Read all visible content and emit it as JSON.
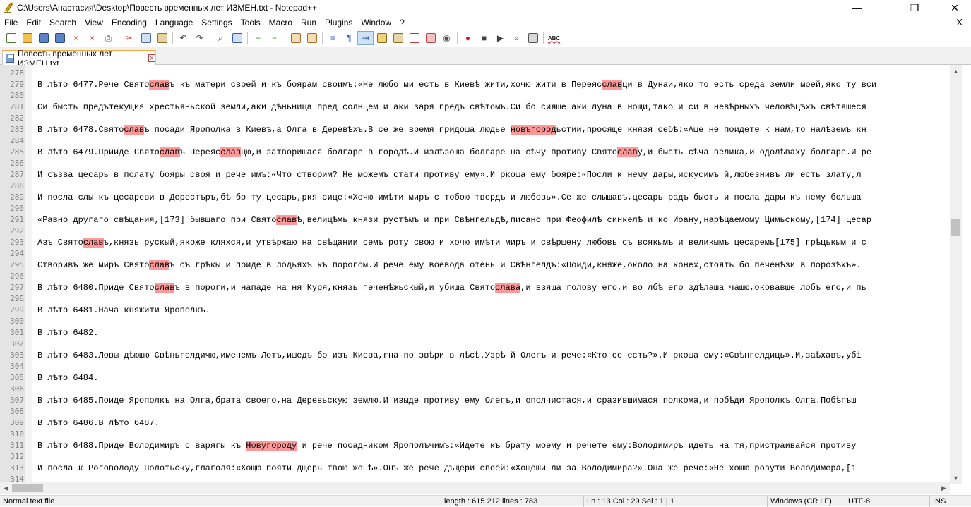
{
  "window": {
    "title": "C:\\Users\\Анастасия\\Desktop\\Повесть временных лет ИЗМЕН.txt - Notepad++",
    "minimize_glyph": "—",
    "restore_glyph": "❐",
    "close_glyph": "✕"
  },
  "menu": [
    "File",
    "Edit",
    "Search",
    "View",
    "Encoding",
    "Language",
    "Settings",
    "Tools",
    "Macro",
    "Run",
    "Plugins",
    "Window",
    "?"
  ],
  "menu_close": "X",
  "toolbar": {
    "icons": [
      "new-file-icon",
      "open-file-icon",
      "save-icon",
      "save-all-icon",
      "close-icon",
      "close-all-icon",
      "print-icon",
      "sep",
      "cut-icon",
      "copy-icon",
      "paste-icon",
      "sep",
      "undo-icon",
      "redo-icon",
      "sep",
      "find-icon",
      "replace-icon",
      "sep",
      "zoom-in-icon",
      "zoom-out-icon",
      "sep",
      "sync-vertical-icon",
      "sync-horizontal-icon",
      "sep",
      "word-wrap-icon",
      "show-all-characters-icon",
      "indent-guide-icon",
      "user-defined-language-icon",
      "document-map-icon",
      "function-list-icon",
      "folder-as-workspace-icon",
      "monitoring-icon",
      "sep",
      "record-macro-icon",
      "stop-recording-icon",
      "playback-macro-icon",
      "run-macro-multiple-icon",
      "save-macro-icon",
      "sep",
      "spell-check-icon"
    ],
    "active": "indent-guide-icon",
    "spell_label": "ABC"
  },
  "tab": {
    "label": "Повесть временных лет ИЗМЕН.txt",
    "close_glyph": "x"
  },
  "editor": {
    "lines": [
      {
        "n": "278",
        "segs": []
      },
      {
        "n": "279",
        "segs": [
          {
            "t": "В лѣто 6477.Рече Свято"
          },
          {
            "t": "слав",
            "h": 1
          },
          {
            "t": "ъ къ матери своей и къ боярам своимъ:«Не любо ми есть в Киевѣ жити,хочю жити в Переяс"
          },
          {
            "t": "слав",
            "h": 1
          },
          {
            "t": "ци в Дунаи,яко то есть среда земли моей,яко ту вси"
          }
        ]
      },
      {
        "n": "280",
        "segs": []
      },
      {
        "n": "281",
        "segs": [
          {
            "t": "Си бысть предътекущия хрестьяньской земли,аки дѣньница пред солнцем и аки заря предъ свѣтомъ.Си бо сияше аки луна в нощи,тако и си в невѣрныхъ человѣцѣхъ свѣтяшеся"
          }
        ]
      },
      {
        "n": "282",
        "segs": []
      },
      {
        "n": "283",
        "segs": [
          {
            "t": "В лѣто 6478.Свято"
          },
          {
            "t": "слав",
            "h": 1
          },
          {
            "t": "ъ посади Ярополка в Киевѣ,а Олга в Деревѣхъ.В се же время придоша людье "
          },
          {
            "t": "новъгород",
            "h": 1
          },
          {
            "t": "ьстии,просяще князя себѣ:«Аще не поидете к нам,то налѣземъ кн"
          }
        ]
      },
      {
        "n": "284",
        "segs": []
      },
      {
        "n": "285",
        "segs": [
          {
            "t": "В лѣто 6479.Прииде Свято"
          },
          {
            "t": "слав",
            "h": 1
          },
          {
            "t": "ъ Переяс"
          },
          {
            "t": "слав",
            "h": 1
          },
          {
            "t": "цю,и затворишася болгаре в городѣ.И излѣзоша болгаре на сѣчу противу Свято"
          },
          {
            "t": "слав",
            "h": 1
          },
          {
            "t": "у,и бысть сѣча велика,и одолѣваху болгаре.И ре"
          }
        ]
      },
      {
        "n": "286",
        "segs": []
      },
      {
        "n": "287",
        "segs": [
          {
            "t": "И съзва цесарь в полату бояры своя и рече имъ:«Что створим? Не можемъ стати противу ему».И ркоша ему бояре:«Посли к нему дары,искусимъ й,любезнивъ ли есть злату,л"
          }
        ]
      },
      {
        "n": "288",
        "segs": []
      },
      {
        "n": "289",
        "segs": [
          {
            "t": "И посла слы къ цесареви в Дерестъръ,бѣ бо ту цесарь,ркя сице:«Хочю имѣти миръ с тобою твердъ и любовь».Се же слышавъ,цесарь радъ бысть и посла дары къ нему больша"
          }
        ]
      },
      {
        "n": "290",
        "segs": []
      },
      {
        "n": "291",
        "segs": [
          {
            "t": "«Равно другаго свѣщания,[173] бывшаго при Свято"
          },
          {
            "t": "слав",
            "h": 1
          },
          {
            "t": "ѣ,велицѣмь князи рустѣмъ и при Свѣнгельдѣ,писано при Феофилѣ синкелѣ и ко Иоану,нарѣцаемому Цимьскому,[174] цесар"
          }
        ]
      },
      {
        "n": "292",
        "segs": []
      },
      {
        "n": "293",
        "segs": [
          {
            "t": "Азъ Свято"
          },
          {
            "t": "слав",
            "h": 1
          },
          {
            "t": "ъ,князь рускый,якоже кляхся,и утвѣржаю на свѣщании семъ роту свою и хочю имѣти миръ и свѣршену любовь съ всякымъ и великымъ цесаремь[175] грѣцькым и с"
          }
        ]
      },
      {
        "n": "294",
        "segs": []
      },
      {
        "n": "295",
        "segs": [
          {
            "t": "Створивъ же миръ Свято"
          },
          {
            "t": "слав",
            "h": 1
          },
          {
            "t": "ъ съ грѣкы и поиде в лодьяхъ къ порогом.И рече ему воевода отень и Свѣнгелдъ:«Поиди,княже,около на конех,стоять бо печенѣзи в порозѣхъ»."
          }
        ]
      },
      {
        "n": "296",
        "segs": []
      },
      {
        "n": "297",
        "segs": [
          {
            "t": "В лѣто 6480.Приде Свято"
          },
          {
            "t": "слав",
            "h": 1
          },
          {
            "t": "ъ в пороги,и нападе на ня Куря,князь печенѣжьскый,и убиша Свято"
          },
          {
            "t": "слава",
            "h": 1
          },
          {
            "t": ",и взяша голову его,и во лбѣ его здѣлаша чашю,оковавше лобъ его,и пь"
          }
        ]
      },
      {
        "n": "298",
        "segs": []
      },
      {
        "n": "299",
        "segs": [
          {
            "t": "В лѣто 6481.Нача княжити Ярополкъ."
          }
        ]
      },
      {
        "n": "300",
        "segs": []
      },
      {
        "n": "301",
        "segs": [
          {
            "t": "В лѣто 6482."
          }
        ]
      },
      {
        "n": "302",
        "segs": []
      },
      {
        "n": "303",
        "segs": [
          {
            "t": "В лѣто 6483.Ловы дѣюшю Свѣньгелдичю,именемъ Лотъ,ишедъ бо изъ Киева,гна по звѣри в лѣсѣ.Узрѣ й Олегъ и рече:«Кто се есть?».И ркоша ему:«Свѣнгелдиць».И,заѣхавъ,убі"
          }
        ]
      },
      {
        "n": "304",
        "segs": []
      },
      {
        "n": "305",
        "segs": [
          {
            "t": "В лѣто 6484."
          }
        ]
      },
      {
        "n": "306",
        "segs": []
      },
      {
        "n": "307",
        "segs": [
          {
            "t": "В лѣто 6485.Поиде Ярополкъ на Олга,брата своего,на Деревьскую землю.И изыде противу ему Олегъ,и ополчистася,и сразившимася полкома,и побѣди Ярополкъ Олга.Побѣгъш"
          }
        ]
      },
      {
        "n": "308",
        "segs": []
      },
      {
        "n": "309",
        "segs": [
          {
            "t": "В лѣто 6486.В лѣто 6487."
          }
        ]
      },
      {
        "n": "310",
        "segs": []
      },
      {
        "n": "311",
        "segs": [
          {
            "t": "В лѣто 6488.Приде Володимиръ с варягы къ "
          },
          {
            "t": "Новугороду",
            "h": 1
          },
          {
            "t": " и рече посадником Ярополъчимъ:«Идете къ брату моему и речете ему:Володимиръ идеть на тя,пристраивайся противу"
          }
        ]
      },
      {
        "n": "312",
        "segs": []
      },
      {
        "n": "313",
        "segs": [
          {
            "t": "И посла к Роговолоду Полотьску,глаголя:«Хощю пояти дщерь твою женѣ».Онъ же рече дъщери своей:«Хощеши ли за Володимира?».Она же рече:«Не хощю розути Володимера,[1"
          }
        ]
      },
      {
        "n": "314",
        "segs": []
      }
    ]
  },
  "scroll": {
    "up_glyph": "▲",
    "down_glyph": "▼",
    "left_glyph": "◀",
    "right_glyph": "▶"
  },
  "status": {
    "file_type": "Normal text file",
    "length_lines": "length : 615 212    lines : 783",
    "position": "Ln : 13    Col : 29    Sel : 1 | 1",
    "eol": "Windows (CR LF)",
    "encoding": "UTF-8",
    "mode": "INS"
  }
}
